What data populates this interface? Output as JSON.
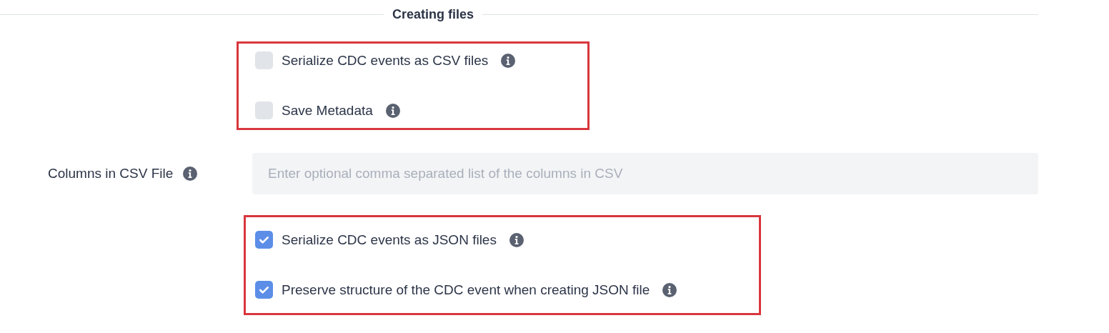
{
  "section": {
    "title": "Creating files"
  },
  "rows": [
    {
      "kind": "checkbox-group",
      "highlighted": true,
      "options": [
        {
          "label": "Serialize CDC events as CSV files",
          "checked": false
        },
        {
          "label": "Save Metadata",
          "checked": false
        }
      ]
    },
    {
      "kind": "field",
      "label": "Columns in CSV File",
      "placeholder": "Enter optional comma separated list of the columns in CSV"
    },
    {
      "kind": "checkbox-group",
      "highlighted": true,
      "options": [
        {
          "label": "Serialize CDC events as JSON files",
          "checked": true
        },
        {
          "label": "Preserve structure of the CDC event when creating JSON file",
          "checked": true
        }
      ]
    }
  ]
}
